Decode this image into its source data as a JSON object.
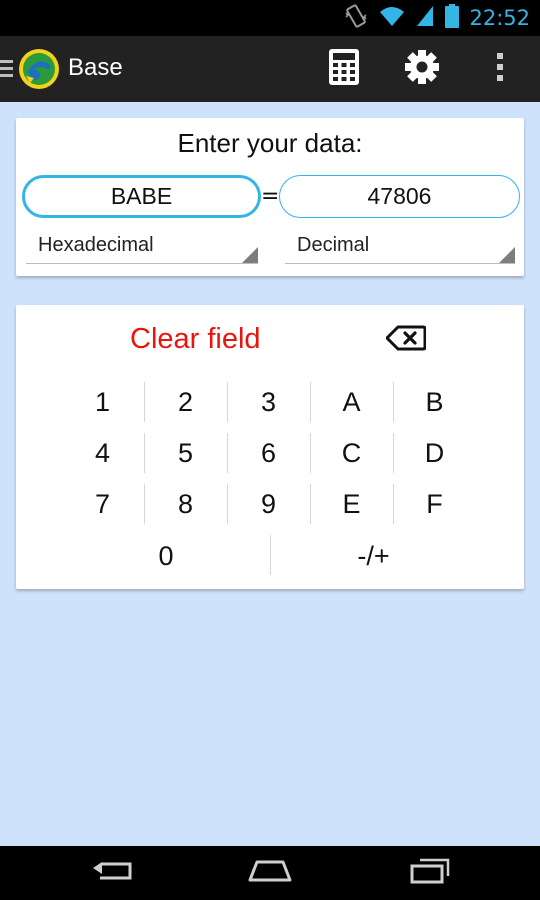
{
  "status_bar": {
    "time": "22:52",
    "icons": [
      "vibrate-icon",
      "wifi-icon",
      "signal-icon",
      "battery-icon"
    ]
  },
  "action_bar": {
    "title": "Base",
    "actions": [
      "calculator-icon",
      "settings-icon",
      "overflow-menu-icon"
    ]
  },
  "input_card": {
    "heading": "Enter your data:",
    "left_value": "BABE",
    "equals": "=",
    "right_value": "47806",
    "left_base": "Hexadecimal",
    "right_base": "Decimal"
  },
  "keypad": {
    "clear_label": "Clear field",
    "rows": [
      [
        "1",
        "2",
        "3",
        "A",
        "B"
      ],
      [
        "4",
        "5",
        "6",
        "C",
        "D"
      ],
      [
        "7",
        "8",
        "9",
        "E",
        "F"
      ]
    ],
    "bottom_row": [
      "0",
      "-/+"
    ]
  },
  "nav_bar": {
    "buttons": [
      "back-icon",
      "home-icon",
      "recent-apps-icon"
    ]
  },
  "colors": {
    "accent": "#33b5e5",
    "clear_red": "#e8140d",
    "background": "#cfe2fb",
    "action_bar": "#222222"
  }
}
